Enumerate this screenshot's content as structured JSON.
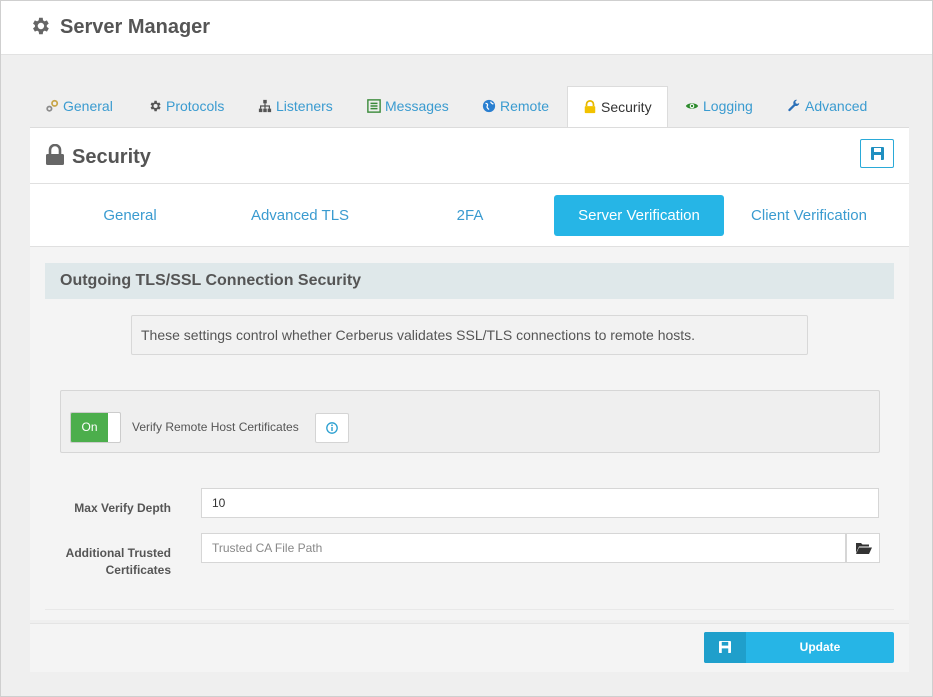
{
  "app": {
    "title": "Server Manager"
  },
  "tabs": [
    {
      "label": "General",
      "icon": "cog-link-icon"
    },
    {
      "label": "Protocols",
      "icon": "gear-icon"
    },
    {
      "label": "Listeners",
      "icon": "sitemap-icon"
    },
    {
      "label": "Messages",
      "icon": "list-icon"
    },
    {
      "label": "Remote",
      "icon": "globe-icon"
    },
    {
      "label": "Security",
      "icon": "lock-icon",
      "active": true
    },
    {
      "label": "Logging",
      "icon": "eye-icon"
    },
    {
      "label": "Advanced",
      "icon": "wrench-icon"
    }
  ],
  "panel": {
    "title": "Security"
  },
  "subtabs": [
    {
      "label": "General"
    },
    {
      "label": "Advanced TLS"
    },
    {
      "label": "2FA"
    },
    {
      "label": "Server Verification",
      "active": true
    },
    {
      "label": "Client Verification"
    }
  ],
  "section": {
    "title": "Outgoing TLS/SSL Connection Security",
    "info": "These settings control whether Cerberus validates SSL/TLS connections to remote hosts."
  },
  "verify_toggle": {
    "state": "On",
    "label": "Verify Remote Host Certificates"
  },
  "fields": {
    "max_verify_depth": {
      "label": "Max Verify Depth",
      "value": "10"
    },
    "trusted_certs": {
      "label_line1": "Additional Trusted",
      "label_line2": "Certificates",
      "value": "",
      "placeholder": "Trusted CA File Path"
    }
  },
  "footer": {
    "update_label": "Update"
  },
  "colors": {
    "accent": "#26b5e6",
    "toggle_on": "#4cae4c",
    "link": "#3a9bd0"
  }
}
